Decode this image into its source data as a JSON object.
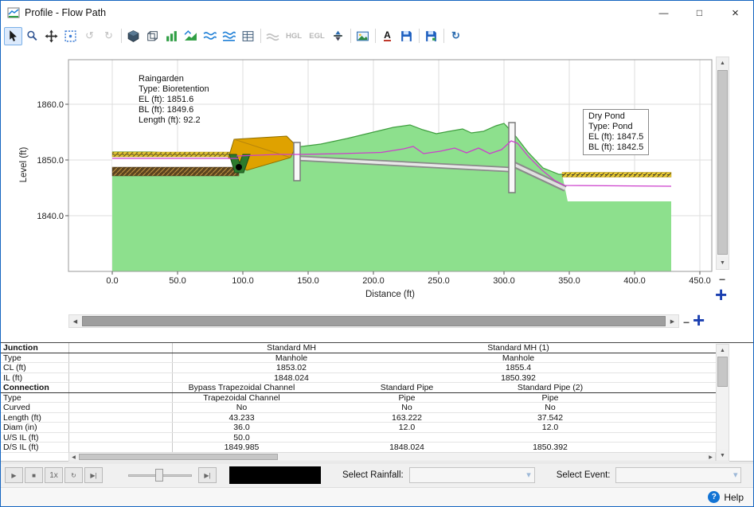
{
  "window": {
    "title": "Profile - Flow Path"
  },
  "icons": {
    "minimize": "—",
    "maximize": "□",
    "close": "×",
    "rotate_ccw": "↺",
    "rotate_cw": "↻",
    "refresh": "↻",
    "annotation_letter": "A",
    "scroll_up": "▲",
    "scroll_down": "▼",
    "scroll_left": "◀",
    "scroll_right": "▶",
    "combo_chevron": "▾",
    "zoom_in": "+",
    "zoom_out": "−",
    "help_glyph": "?"
  },
  "toolbar": {
    "hgl": "HGL",
    "egl": "EGL"
  },
  "chart": {
    "ylabel": "Level (ft)",
    "xlabel": "Distance (ft)",
    "y_ticks": [
      "1860.0",
      "1850.0",
      "1840.0"
    ],
    "x_ticks": [
      "0.0",
      "50.0",
      "100.0",
      "150.0",
      "200.0",
      "250.0",
      "300.0",
      "350.0",
      "400.0",
      "450.0"
    ],
    "annotations": {
      "raingarden": [
        "Raingarden",
        "Type: Bioretention",
        "EL (ft): 1851.6",
        "BL (ft): 1849.6",
        "Length (ft): 92.2"
      ],
      "dry_pond": [
        "Dry Pond",
        "Type: Pond",
        "EL (ft): 1847.5",
        "BL (ft): 1842.5"
      ]
    }
  },
  "table": {
    "rows": [
      {
        "label": "Junction",
        "j1": "Standard MH",
        "j2": "Standard MH (1)"
      },
      {
        "label": "Type",
        "j1": "Manhole",
        "j2": "Manhole"
      },
      {
        "label": "CL (ft)",
        "j1": "1853.02",
        "j2": "1855.4"
      },
      {
        "label": "IL (ft)",
        "j1": "1848.024",
        "j2": "1850.392"
      },
      {
        "label": "Connection",
        "c1": "Bypass Trapezoidal Channel",
        "c2": "Standard Pipe",
        "c3": "Standard Pipe (2)"
      },
      {
        "label": "Type",
        "c1": "Trapezoidal Channel",
        "c2": "Pipe",
        "c3": "Pipe"
      },
      {
        "label": "Curved",
        "c1": "No",
        "c2": "No",
        "c3": "No"
      },
      {
        "label": "Length (ft)",
        "c1": "43.233",
        "c2": "163.222",
        "c3": "37.542"
      },
      {
        "label": "Diam (in)",
        "c1": "36.0",
        "c2": "12.0",
        "c3": "12.0"
      },
      {
        "label": "U/S IL (ft)",
        "c1": "50.0"
      },
      {
        "label": "D/S IL (ft)",
        "c1": "1849.985",
        "c2": "1848.024",
        "c3": "1850.392"
      }
    ]
  },
  "playback": {
    "buttons": [
      {
        "name": "play-button",
        "glyph": "▶"
      },
      {
        "name": "stop-button",
        "glyph": "■"
      },
      {
        "name": "speed-button",
        "glyph": "1x"
      },
      {
        "name": "repeat-button",
        "glyph": "↻"
      },
      {
        "name": "step-forward-button",
        "glyph": "▶|"
      },
      {
        "name": "skip-end-button",
        "glyph": "▶|"
      }
    ]
  },
  "filters": {
    "rainfall_label": "Select Rainfall:",
    "rainfall_value": "",
    "event_label": "Select Event:",
    "event_value": ""
  },
  "status": {
    "help": "Help"
  }
}
